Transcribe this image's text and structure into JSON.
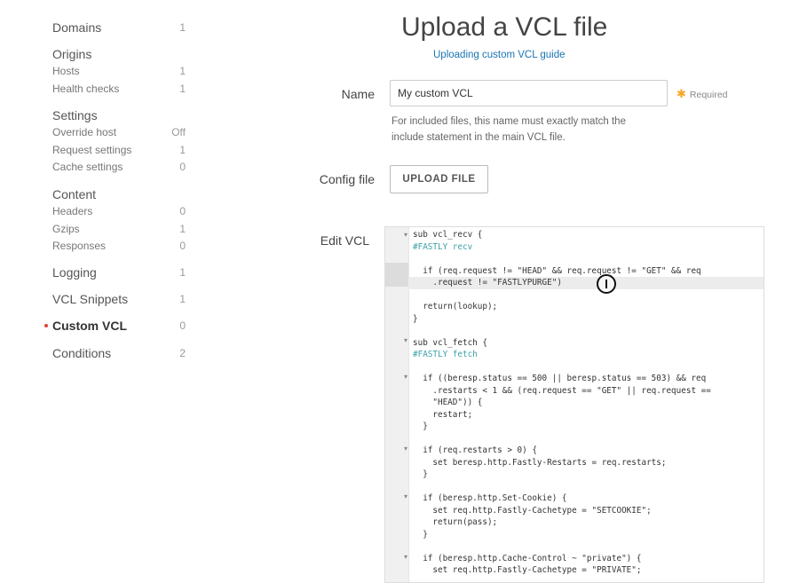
{
  "sidebar": {
    "domains": {
      "label": "Domains",
      "count": "1"
    },
    "origins": {
      "label": "Origins",
      "items": [
        {
          "label": "Hosts",
          "count": "1"
        },
        {
          "label": "Health checks",
          "count": "1"
        }
      ]
    },
    "settings": {
      "label": "Settings",
      "items": [
        {
          "label": "Override host",
          "count": "Off"
        },
        {
          "label": "Request settings",
          "count": "1"
        },
        {
          "label": "Cache settings",
          "count": "0"
        }
      ]
    },
    "content": {
      "label": "Content",
      "items": [
        {
          "label": "Headers",
          "count": "0"
        },
        {
          "label": "Gzips",
          "count": "1"
        },
        {
          "label": "Responses",
          "count": "0"
        }
      ]
    },
    "logging": {
      "label": "Logging",
      "count": "1"
    },
    "vcl_snippets": {
      "label": "VCL Snippets",
      "count": "1"
    },
    "custom_vcl": {
      "label": "Custom VCL",
      "count": "0"
    },
    "conditions": {
      "label": "Conditions",
      "count": "2"
    }
  },
  "main": {
    "title": "Upload a VCL file",
    "guide_link": "Uploading custom VCL guide",
    "name_label": "Name",
    "name_value": "My custom VCL",
    "required_label": "Required",
    "help_text": "For included files, this name must exactly match the include statement in the main VCL file.",
    "config_label": "Config file",
    "upload_button": "UPLOAD FILE",
    "edit_label": "Edit VCL"
  },
  "editor": {
    "lines": [
      "sub vcl_recv {",
      "#FASTLY recv",
      "",
      "  if (req.request != \"HEAD\" && req.request != \"GET\" && req",
      "    .request != \"FASTLYPURGE\")",
      "",
      "  return(lookup);",
      "}",
      "",
      "sub vcl_fetch {",
      "#FASTLY fetch",
      "",
      "  if ((beresp.status == 500 || beresp.status == 503) && req",
      "    .restarts < 1 && (req.request == \"GET\" || req.request ==",
      "    \"HEAD\")) {",
      "    restart;",
      "  }",
      "",
      "  if (req.restarts > 0) {",
      "    set beresp.http.Fastly-Restarts = req.restarts;",
      "  }",
      "",
      "  if (beresp.http.Set-Cookie) {",
      "    set req.http.Fastly-Cachetype = \"SETCOOKIE\";",
      "    return(pass);",
      "  }",
      "",
      "  if (beresp.http.Cache-Control ~ \"private\") {",
      "    set req.http.Fastly-Cachetype = \"PRIVATE\";"
    ]
  },
  "colors": {
    "accent_link": "#1a74b3",
    "required_star": "#f5a623",
    "active_dot": "#e2413b"
  }
}
